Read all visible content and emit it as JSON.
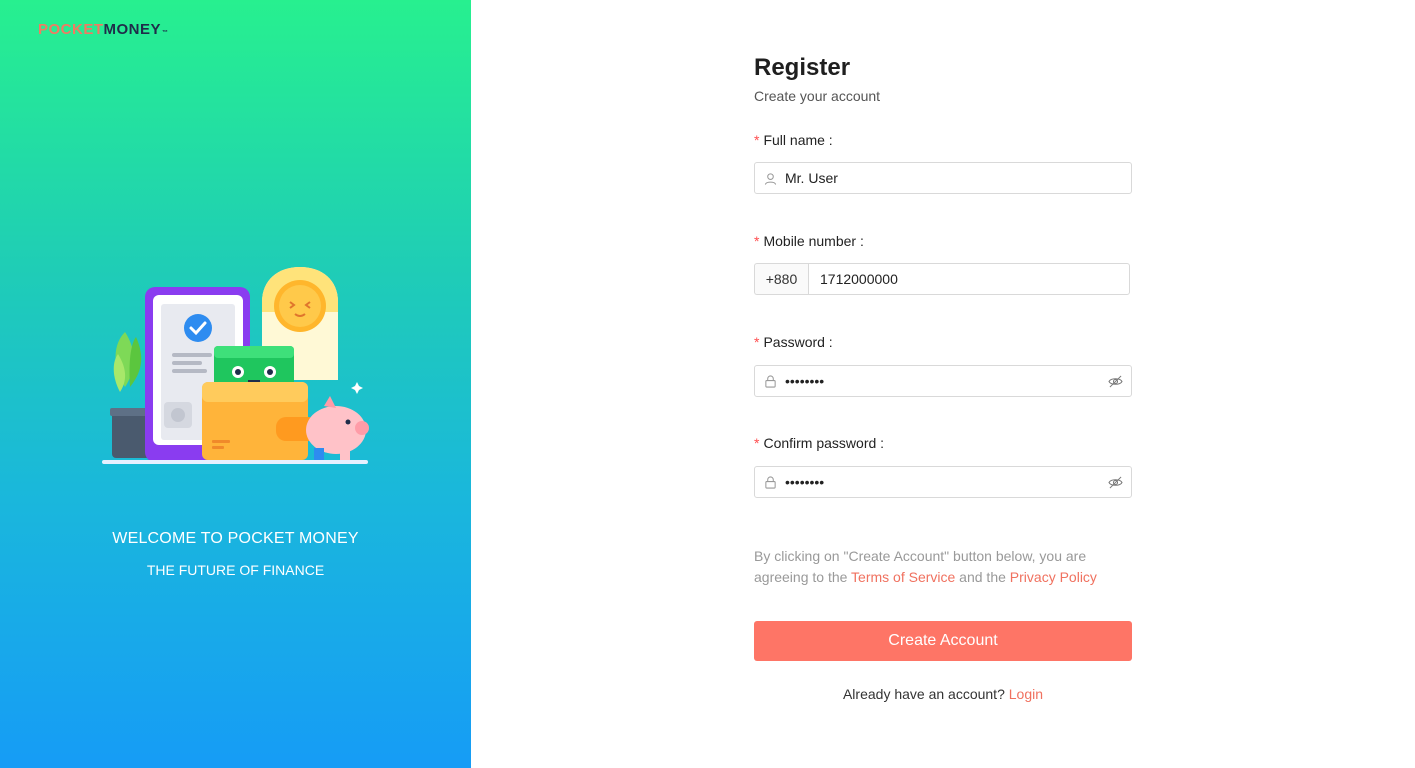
{
  "brand": {
    "logo_part1": "POCKET",
    "logo_part2": "MONEY",
    "trademark": "™"
  },
  "hero": {
    "welcome": "WELCOME TO POCKET MONEY",
    "tagline": "THE FUTURE OF FINANCE"
  },
  "form": {
    "title": "Register",
    "subtitle": "Create your account",
    "full_name": {
      "label": "Full name",
      "value": "Mr. User"
    },
    "mobile": {
      "label": "Mobile number",
      "prefix": "+880",
      "value": "1712000000"
    },
    "password": {
      "label": "Password",
      "value": "••••••••"
    },
    "confirm_password": {
      "label": "Confirm password",
      "value": "••••••••"
    },
    "required_mark": "*",
    "agreement": {
      "text_1": "By clicking on \"Create Account\" button below, you are agreeing to the ",
      "terms_link": "Terms of Service",
      "text_2": " and the ",
      "privacy_link": "Privacy Policy"
    },
    "submit_label": "Create Account",
    "login_prompt": "Already have an account?",
    "login_link": "Login"
  },
  "colors": {
    "accent": "#fe7566",
    "link": "#f0715f",
    "gradient_top": "#27f08f",
    "gradient_bottom": "#169cf6"
  },
  "icons": [
    "user-icon",
    "lock-icon",
    "eye-invisible-icon"
  ]
}
